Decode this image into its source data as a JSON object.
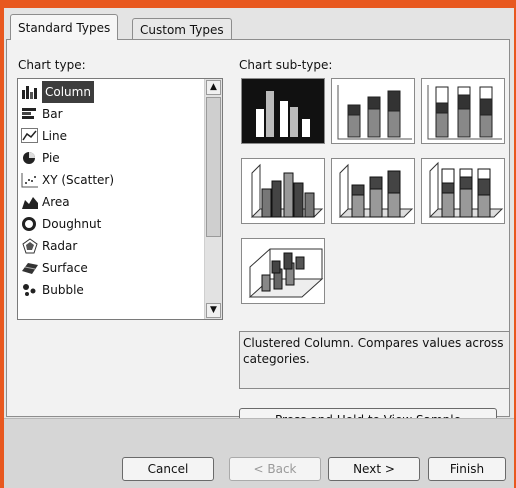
{
  "tabs": [
    {
      "label": "Standard Types",
      "active": true
    },
    {
      "label": "Custom Types",
      "active": false
    }
  ],
  "chart_type_label": "Chart type:",
  "chart_subtype_label": "Chart sub-type:",
  "chart_types": [
    {
      "label": "Column",
      "icon": "column-chart-icon",
      "selected": true
    },
    {
      "label": "Bar",
      "icon": "bar-chart-icon",
      "selected": false
    },
    {
      "label": "Line",
      "icon": "line-chart-icon",
      "selected": false
    },
    {
      "label": "Pie",
      "icon": "pie-chart-icon",
      "selected": false
    },
    {
      "label": "XY (Scatter)",
      "icon": "scatter-chart-icon",
      "selected": false
    },
    {
      "label": "Area",
      "icon": "area-chart-icon",
      "selected": false
    },
    {
      "label": "Doughnut",
      "icon": "doughnut-chart-icon",
      "selected": false
    },
    {
      "label": "Radar",
      "icon": "radar-chart-icon",
      "selected": false
    },
    {
      "label": "Surface",
      "icon": "surface-chart-icon",
      "selected": false
    },
    {
      "label": "Bubble",
      "icon": "bubble-chart-icon",
      "selected": false
    }
  ],
  "subtypes": [
    {
      "name": "clustered-column",
      "selected": true
    },
    {
      "name": "stacked-column",
      "selected": false
    },
    {
      "name": "100-stacked-column",
      "selected": false
    },
    {
      "name": "clustered-column-3d",
      "selected": false
    },
    {
      "name": "stacked-column-3d",
      "selected": false
    },
    {
      "name": "100-stacked-column-3d",
      "selected": false
    },
    {
      "name": "3d-column",
      "selected": false
    }
  ],
  "description": "Clustered Column. Compares values across categories.",
  "buttons": {
    "sample": "Press and Hold to View Sample",
    "cancel": "Cancel",
    "back": "< Back",
    "next": "Next >",
    "finish": "Finish"
  },
  "colors": {
    "selection": "#3d3d3d",
    "background": "#e8581f"
  }
}
